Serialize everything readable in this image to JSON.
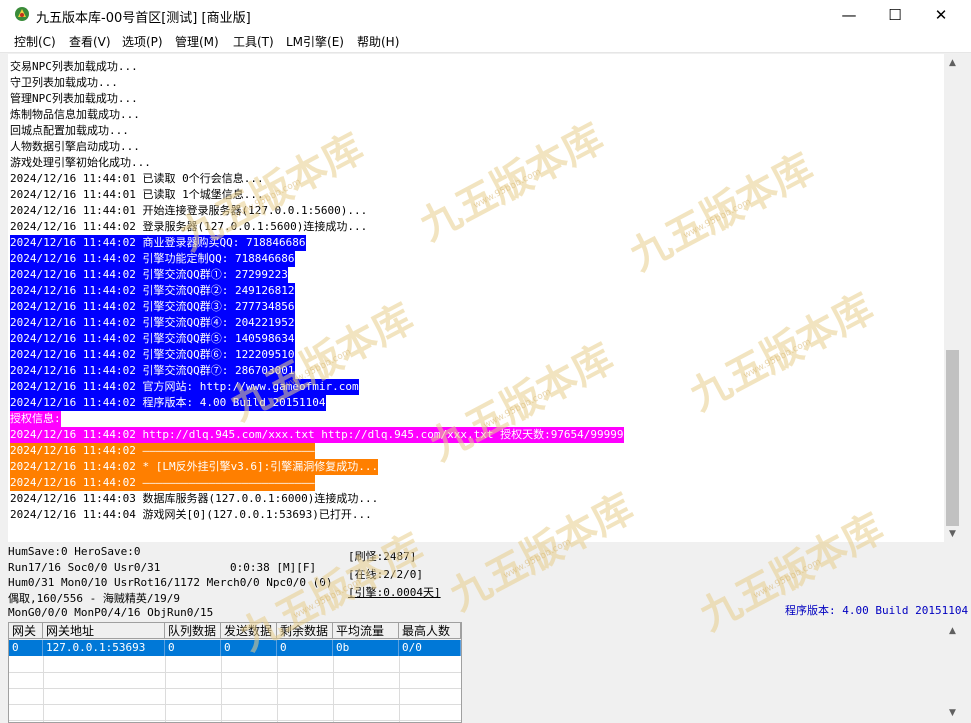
{
  "window": {
    "title": "九五版本库-00号首区[测试] [商业版]",
    "controls": {
      "minimize": "—",
      "maximize": "☐",
      "close": "✕"
    }
  },
  "menu": [
    "控制(C)",
    "查看(V)",
    "选项(P)",
    "管理(M)",
    "工具(T)",
    "LM引擎(E)",
    "帮助(H)"
  ],
  "log": [
    {
      "text": "交易NPC列表加载成功...",
      "style": "plain"
    },
    {
      "text": "守卫列表加载成功...",
      "style": "plain"
    },
    {
      "text": "管理NPC列表加载成功...",
      "style": "plain"
    },
    {
      "text": "炼制物品信息加载成功...",
      "style": "plain"
    },
    {
      "text": "回城点配置加载成功...",
      "style": "plain"
    },
    {
      "text": "人物数据引擎启动成功...",
      "style": "plain"
    },
    {
      "text": "游戏处理引擎初始化成功...",
      "style": "plain"
    },
    {
      "text": "2024/12/16 11:44:01 已读取 0个行会信息...",
      "style": "plain"
    },
    {
      "text": "2024/12/16 11:44:01 已读取 1个城堡信息...",
      "style": "plain"
    },
    {
      "text": "2024/12/16 11:44:01 开始连接登录服务器(127.0.0.1:5600)...",
      "style": "plain"
    },
    {
      "text": "2024/12/16 11:44:02 登录服务器(127.0.0.1:5600)连接成功...",
      "style": "plain"
    },
    {
      "text": "2024/12/16 11:44:02 商业登录器购买QQ: 718846686",
      "style": "blue"
    },
    {
      "text": "2024/12/16 11:44:02 引擎功能定制QQ: 718846686",
      "style": "blue"
    },
    {
      "text": "2024/12/16 11:44:02 引擎交流QQ群①: 27299223",
      "style": "blue"
    },
    {
      "text": "2024/12/16 11:44:02 引擎交流QQ群②: 249126812",
      "style": "blue"
    },
    {
      "text": "2024/12/16 11:44:02 引擎交流QQ群③: 277734856",
      "style": "blue"
    },
    {
      "text": "2024/12/16 11:44:02 引擎交流QQ群④: 204221952",
      "style": "blue"
    },
    {
      "text": "2024/12/16 11:44:02 引擎交流QQ群⑤: 140598634",
      "style": "blue"
    },
    {
      "text": "2024/12/16 11:44:02 引擎交流QQ群⑥: 122209510",
      "style": "blue"
    },
    {
      "text": "2024/12/16 11:44:02 引擎交流QQ群⑦: 286703001",
      "style": "blue"
    },
    {
      "text": "2024/12/16 11:44:02 官方网站: http://www.gameofmir.com",
      "style": "blue"
    },
    {
      "text": "2024/12/16 11:44:02 程序版本: 4.00 Build 20151104",
      "style": "blue"
    },
    {
      "text": "授权信息:",
      "style": "magenta"
    },
    {
      "text": "2024/12/16 11:44:02 http://dlq.945.com/xxx.txt http://dlq.945.com/xxx.txt 授权天数:97654/99999",
      "style": "magenta"
    },
    {
      "text": "2024/12/16 11:44:02 ——————————————————————————",
      "style": "orange"
    },
    {
      "text": "2024/12/16 11:44:02 * [LM反外挂引擎v3.6]:引擎漏洞修复成功...",
      "style": "orange"
    },
    {
      "text": "2024/12/16 11:44:02 ——————————————————————————",
      "style": "orange"
    },
    {
      "text": "2024/12/16 11:44:03 数据库服务器(127.0.0.1:6000)连接成功...",
      "style": "plain"
    },
    {
      "text": "2024/12/16 11:44:04 游戏网关[0](127.0.0.1:53693)已打开...",
      "style": "plain"
    }
  ],
  "status": {
    "line1": "HumSave:0 HeroSave:0",
    "line2": "Run17/16 Soc0/0 Usr0/31",
    "timer": "0:0:38 [M][F]",
    "line3": "Hum0/31 Mon0/10 UsrRot16/1172 Merch0/0 Npc0/0 (0)",
    "line4": "偶取,160/556 - 海贼精英/19/9",
    "line5": "MonG0/0/0 MonP0/4/16 ObjRun0/15",
    "refresh_monsters": "[刷怪:2487]",
    "online": "[在线:2/2/0]",
    "engine": "[引擎:0.0004天]",
    "version": "程序版本: 4.00 Build 20151104"
  },
  "gateway_table": {
    "headers": [
      "网关",
      "网关地址",
      "队列数据",
      "发送数据",
      "剩余数据",
      "平均流量",
      "最高人数"
    ],
    "rows": [
      [
        "0",
        "127.0.0.1:53693",
        "0",
        "0",
        "0",
        "0b",
        "0/0"
      ]
    ]
  },
  "watermark": {
    "main": "九五版本库",
    "sub": "www.95bbb.com"
  },
  "colors": {
    "log_blue": "#0000ff",
    "log_magenta": "#ff00ff",
    "log_orange": "#ff7f00",
    "selection": "#0078d7",
    "version_text": "#0000c0"
  },
  "icons": {
    "app": "app-logo-icon",
    "scroll_up": "arrow-up-icon",
    "scroll_down": "arrow-down-icon"
  }
}
